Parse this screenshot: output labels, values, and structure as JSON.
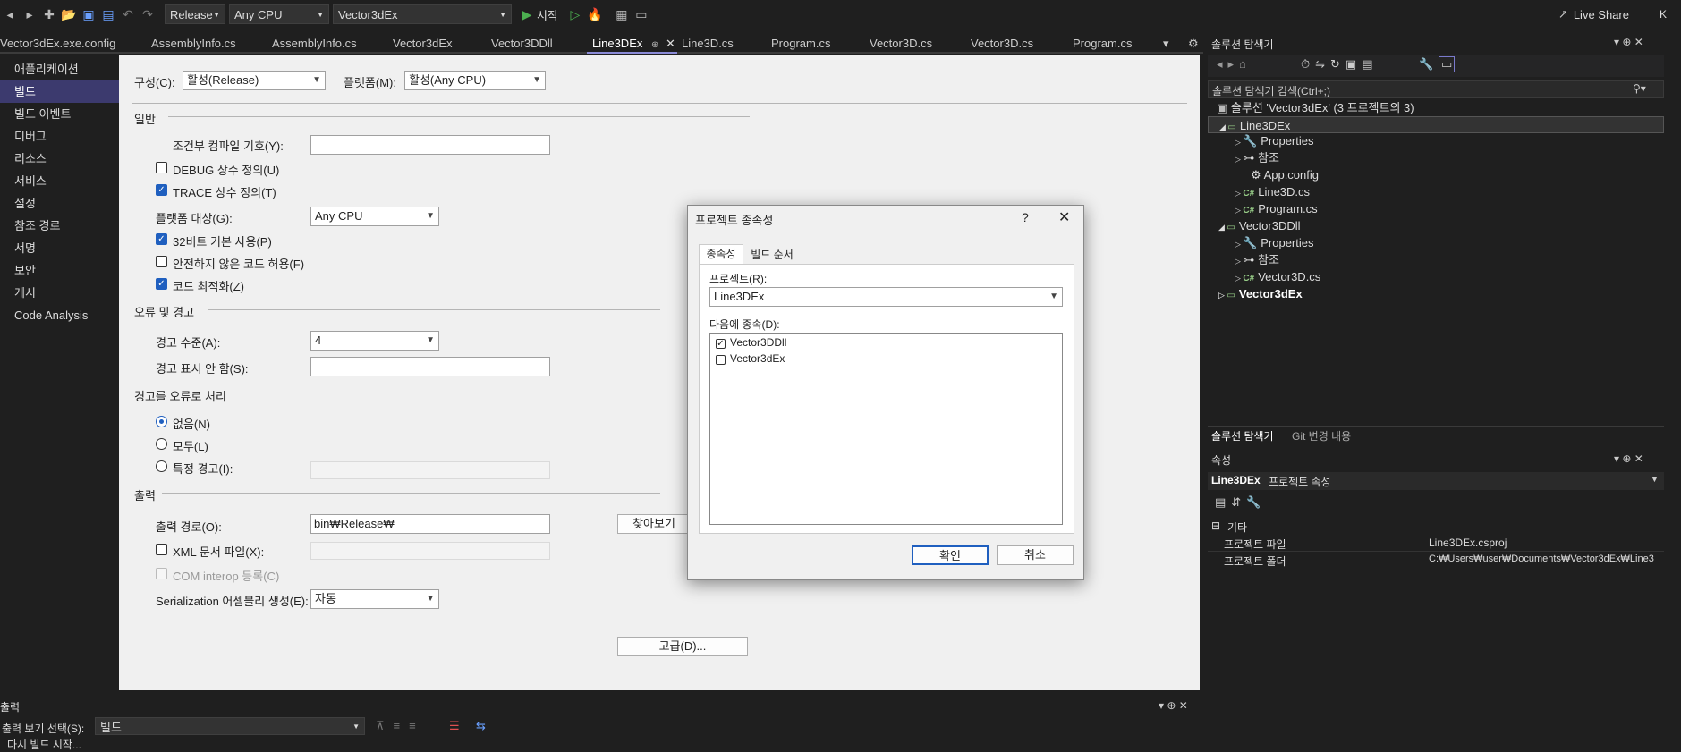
{
  "toolbar": {
    "config": "Release",
    "platform": "Any CPU",
    "startup_project": "Vector3dEx",
    "start_label": "시작",
    "live_share": "Live Share",
    "user_initial": "K"
  },
  "tabs": [
    {
      "label": "Vector3dEx.exe.config"
    },
    {
      "label": "AssemblyInfo.cs"
    },
    {
      "label": "AssemblyInfo.cs"
    },
    {
      "label": "Vector3dEx"
    },
    {
      "label": "Vector3DDll"
    },
    {
      "label": "Line3DEx",
      "active": true
    },
    {
      "label": "Line3D.cs"
    },
    {
      "label": "Program.cs"
    },
    {
      "label": "Vector3D.cs"
    },
    {
      "label": "Vector3D.cs"
    },
    {
      "label": "Program.cs"
    }
  ],
  "nav": {
    "items": [
      {
        "label": "애플리케이션"
      },
      {
        "label": "빌드"
      },
      {
        "label": "빌드 이벤트"
      },
      {
        "label": "디버그"
      },
      {
        "label": "리소스"
      },
      {
        "label": "서비스"
      },
      {
        "label": "설정"
      },
      {
        "label": "참조 경로"
      },
      {
        "label": "서명"
      },
      {
        "label": "보안"
      },
      {
        "label": "게시"
      },
      {
        "label": "Code Analysis"
      }
    ]
  },
  "build": {
    "config_label": "구성(C):",
    "config_value": "활성(Release)",
    "platform_label": "플랫폼(M):",
    "platform_value": "활성(Any CPU)",
    "general": "일반",
    "cond_symbols": "조건부 컴파일 기호(Y):",
    "debug_const": "DEBUG 상수 정의(U)",
    "trace_const": "TRACE 상수 정의(T)",
    "platform_target": "플랫폼 대상(G):",
    "platform_target_value": "Any CPU",
    "prefer32": "32비트 기본 사용(P)",
    "unsafe": "안전하지 않은 코드 허용(F)",
    "optimize": "코드 최적화(Z)",
    "errors": "오류 및 경고",
    "warn_level": "경고 수준(A):",
    "warn_level_value": "4",
    "suppress": "경고 표시 안 함(S):",
    "treat_warn": "경고를 오류로 처리",
    "none": "없음(N)",
    "all": "모두(L)",
    "specific": "특정 경고(I):",
    "output": "출력",
    "output_path": "출력 경로(O):",
    "output_path_value": "bin₩Release₩",
    "browse": "찾아보기",
    "xml_doc": "XML 문서 파일(X):",
    "com_interop": "COM interop 등록(C)",
    "serialization": "Serialization 어셈블리 생성(E):",
    "serialization_value": "자동",
    "advanced": "고급(D)..."
  },
  "dialog": {
    "title": "프로젝트 종속성",
    "help": "?",
    "tab_deps": "종속성",
    "tab_order": "빌드 순서",
    "project_label": "프로젝트(R):",
    "project_value": "Line3DEx",
    "depends_label": "다음에 종속(D):",
    "items": [
      {
        "label": "Vector3DDll",
        "checked": true
      },
      {
        "label": "Vector3dEx",
        "checked": false
      }
    ],
    "ok": "확인",
    "cancel": "취소"
  },
  "solution_explorer": {
    "title": "솔루션 탐색기",
    "search": "솔루션 탐색기 검색(Ctrl+;)",
    "solution": "솔루션 'Vector3dEx'  (3 프로젝트의 3)",
    "tree": [
      {
        "label": "Line3DEx"
      },
      {
        "label": "Properties"
      },
      {
        "label": "참조"
      },
      {
        "label": "App.config"
      },
      {
        "label": "Line3D.cs"
      },
      {
        "label": "Program.cs"
      },
      {
        "label": "Vector3DDll"
      },
      {
        "label": "Properties"
      },
      {
        "label": "참조"
      },
      {
        "label": "Vector3D.cs"
      },
      {
        "label": "Vector3dEx"
      }
    ],
    "tab_se": "솔루션 탐색기",
    "tab_git": "Git 변경 내용"
  },
  "properties": {
    "title": "속성",
    "object": "Line3DEx",
    "object_type": "프로젝트 속성",
    "category": "기타",
    "rows": [
      {
        "name": "프로젝트 파일",
        "value": "Line3DEx.csproj"
      },
      {
        "name": "프로젝트 폴더",
        "value": "C:₩Users₩user₩Documents₩Vector3dEx₩Line3"
      }
    ]
  },
  "output": {
    "title": "출력",
    "show_from": "출력 보기 선택(S):",
    "source": "빌드",
    "line1": "다시 빌드 시작..."
  }
}
